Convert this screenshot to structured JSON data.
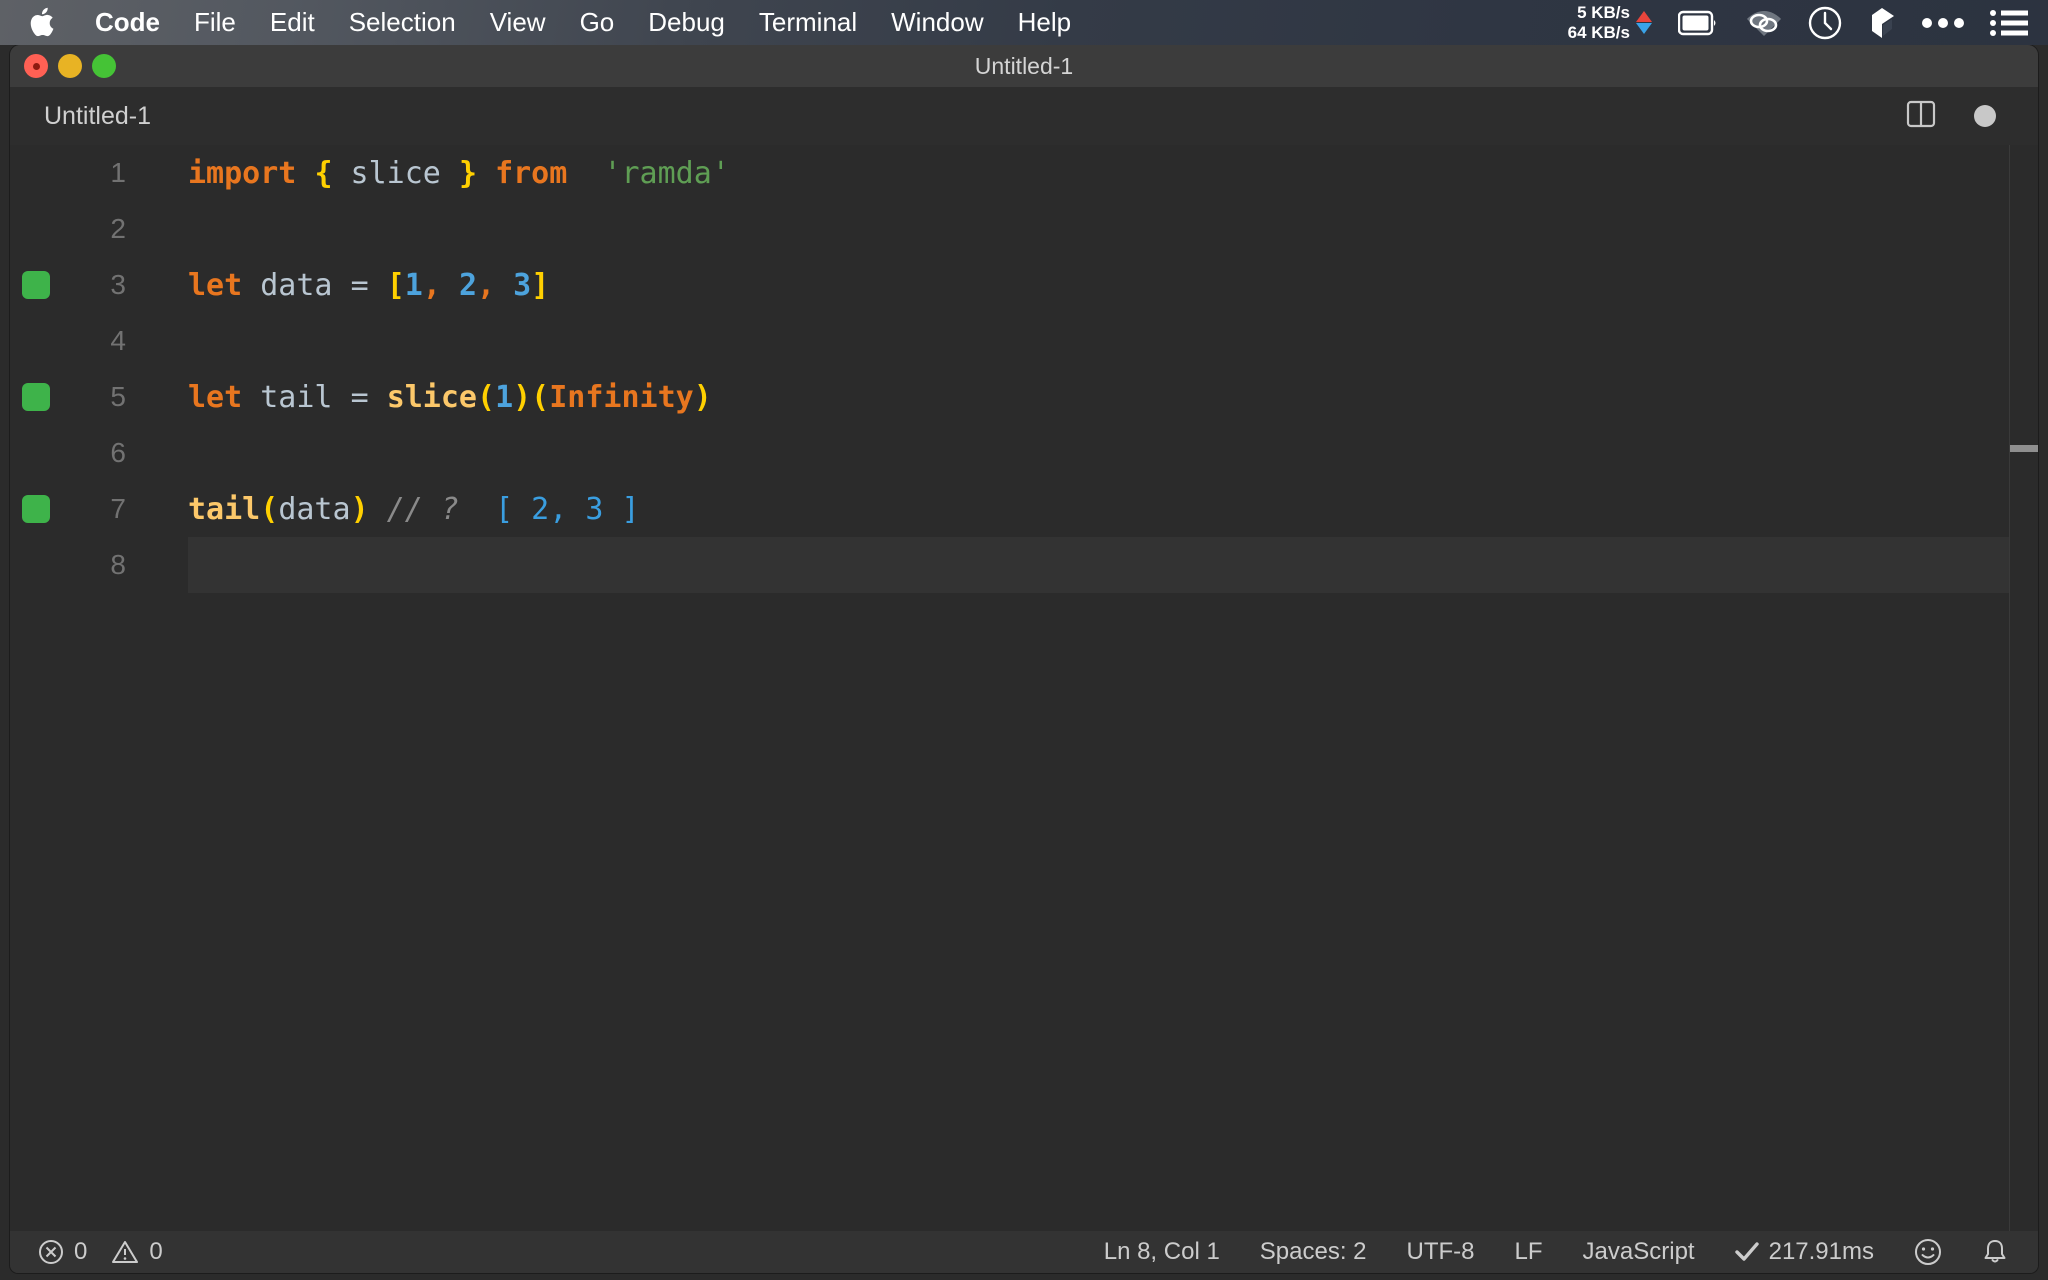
{
  "menubar": {
    "apple_icon": "apple-logo-icon",
    "items": [
      {
        "label": "Code",
        "bold": true
      },
      {
        "label": "File",
        "bold": false
      },
      {
        "label": "Edit",
        "bold": false
      },
      {
        "label": "Selection",
        "bold": false
      },
      {
        "label": "View",
        "bold": false
      },
      {
        "label": "Go",
        "bold": false
      },
      {
        "label": "Debug",
        "bold": false
      },
      {
        "label": "Terminal",
        "bold": false
      },
      {
        "label": "Window",
        "bold": false
      },
      {
        "label": "Help",
        "bold": false
      }
    ],
    "network": {
      "upload": "5 KB/s",
      "download": "64 KB/s",
      "upload_color": "#e8453c",
      "download_color": "#3aa3e8"
    },
    "status_icons": [
      "battery-icon",
      "wifi-icon",
      "clock-icon",
      "dropbox-icon",
      "ellipsis-icon",
      "list-menu-icon"
    ]
  },
  "window": {
    "title": "Untitled-1",
    "traffic_lights": [
      "close-button",
      "minimize-button",
      "maximize-button"
    ]
  },
  "tabbar": {
    "tabs": [
      {
        "label": "Untitled-1",
        "active": true
      }
    ],
    "actions": [
      "split-editor-icon",
      "unsaved-indicator"
    ]
  },
  "editor": {
    "language": "JavaScript",
    "lines": [
      {
        "number": "1",
        "marker": false,
        "active": false,
        "tokens": [
          {
            "text": "import",
            "type": "keyword"
          },
          {
            "text": " ",
            "type": "plain"
          },
          {
            "text": "{",
            "type": "brace"
          },
          {
            "text": " slice ",
            "type": "ident"
          },
          {
            "text": "}",
            "type": "brace"
          },
          {
            "text": " ",
            "type": "plain"
          },
          {
            "text": "from",
            "type": "keyword"
          },
          {
            "text": "  ",
            "type": "plain"
          },
          {
            "text": "'ramda'",
            "type": "string"
          }
        ]
      },
      {
        "number": "2",
        "marker": false,
        "active": false,
        "tokens": []
      },
      {
        "number": "3",
        "marker": true,
        "active": false,
        "tokens": [
          {
            "text": "let",
            "type": "keyword"
          },
          {
            "text": " data ",
            "type": "ident"
          },
          {
            "text": "=",
            "type": "op"
          },
          {
            "text": " ",
            "type": "plain"
          },
          {
            "text": "[",
            "type": "brace"
          },
          {
            "text": "1",
            "type": "num"
          },
          {
            "text": ",",
            "type": "comma"
          },
          {
            "text": " ",
            "type": "plain"
          },
          {
            "text": "2",
            "type": "num"
          },
          {
            "text": ",",
            "type": "comma"
          },
          {
            "text": " ",
            "type": "plain"
          },
          {
            "text": "3",
            "type": "num"
          },
          {
            "text": "]",
            "type": "brace"
          }
        ]
      },
      {
        "number": "4",
        "marker": false,
        "active": false,
        "tokens": []
      },
      {
        "number": "5",
        "marker": true,
        "active": false,
        "tokens": [
          {
            "text": "let",
            "type": "keyword"
          },
          {
            "text": " tail ",
            "type": "ident"
          },
          {
            "text": "=",
            "type": "op"
          },
          {
            "text": " ",
            "type": "plain"
          },
          {
            "text": "slice",
            "type": "func"
          },
          {
            "text": "(",
            "type": "brace"
          },
          {
            "text": "1",
            "type": "num"
          },
          {
            "text": ")(",
            "type": "brace"
          },
          {
            "text": "Infinity",
            "type": "keyword"
          },
          {
            "text": ")",
            "type": "brace"
          }
        ]
      },
      {
        "number": "6",
        "marker": false,
        "active": false,
        "tokens": []
      },
      {
        "number": "7",
        "marker": true,
        "active": false,
        "tokens": [
          {
            "text": "tail",
            "type": "func"
          },
          {
            "text": "(",
            "type": "brace"
          },
          {
            "text": "data",
            "type": "ident"
          },
          {
            "text": ")",
            "type": "brace"
          },
          {
            "text": " ",
            "type": "plain"
          },
          {
            "text": "// ?",
            "type": "comment"
          },
          {
            "text": "  ",
            "type": "plain"
          },
          {
            "text": "[ 2, 3 ]",
            "type": "result"
          }
        ]
      },
      {
        "number": "8",
        "marker": false,
        "active": true,
        "tokens": []
      }
    ]
  },
  "statusbar": {
    "left": [
      {
        "icon": "error-icon",
        "label": "0"
      },
      {
        "icon": "warning-icon",
        "label": "0"
      }
    ],
    "right": [
      {
        "icon": null,
        "label": "Ln 8, Col 1"
      },
      {
        "icon": null,
        "label": "Spaces: 2"
      },
      {
        "icon": null,
        "label": "UTF-8"
      },
      {
        "icon": null,
        "label": "LF"
      },
      {
        "icon": null,
        "label": "JavaScript"
      },
      {
        "icon": "checkmark-icon",
        "label": "217.91ms"
      },
      {
        "icon": "smiley-icon",
        "label": ""
      },
      {
        "icon": "bell-icon",
        "label": ""
      }
    ]
  },
  "colors": {
    "menubar_text": "#ffffff",
    "editor_bg": "#2b2b2b",
    "titlebar_bg": "#3c3c3c",
    "tabbar_bg": "#2d2d2d",
    "statusbar_bg": "#333333",
    "marker_green": "#3eb34a",
    "keyword": "#e8761f",
    "brace": "#ffd000",
    "string": "#5f9e54",
    "number": "#4da3dd",
    "function": "#fcc86a",
    "comment": "#8a8a8a",
    "result": "#3a9ee0"
  }
}
